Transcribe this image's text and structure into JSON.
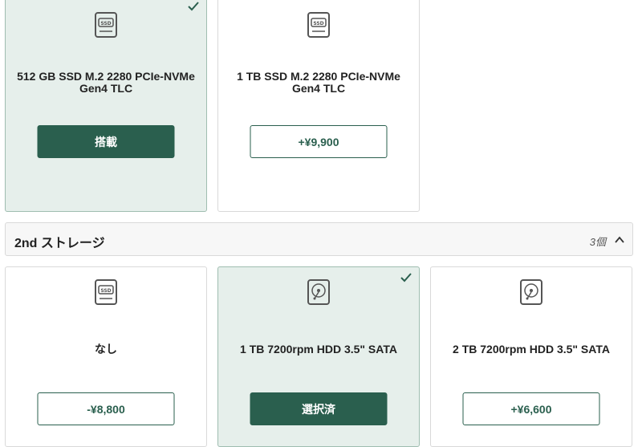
{
  "storage_1": {
    "options": [
      {
        "name": "512 GB SSD M.2 2280 PCIe-NVMe Gen4 TLC",
        "icon": "ssd-icon",
        "button": "搭載",
        "selected": true
      },
      {
        "name": "1 TB SSD M.2 2280 PCIe-NVMe Gen4 TLC",
        "icon": "ssd-icon",
        "button": "+¥9,900",
        "selected": false
      }
    ]
  },
  "storage_2": {
    "title": "2nd ストレージ",
    "count": "3個",
    "options": [
      {
        "name": "なし",
        "icon": "ssd-icon",
        "button": "-¥8,800",
        "selected": false
      },
      {
        "name": "1 TB 7200rpm HDD 3.5\" SATA",
        "icon": "hdd-icon",
        "button": "選択済",
        "selected": true
      },
      {
        "name": "2 TB 7200rpm HDD 3.5\" SATA",
        "icon": "hdd-icon",
        "button": "+¥6,600",
        "selected": false
      }
    ]
  },
  "colors": {
    "accent": "#2a5f4e",
    "selected_bg": "#e6efeb"
  }
}
